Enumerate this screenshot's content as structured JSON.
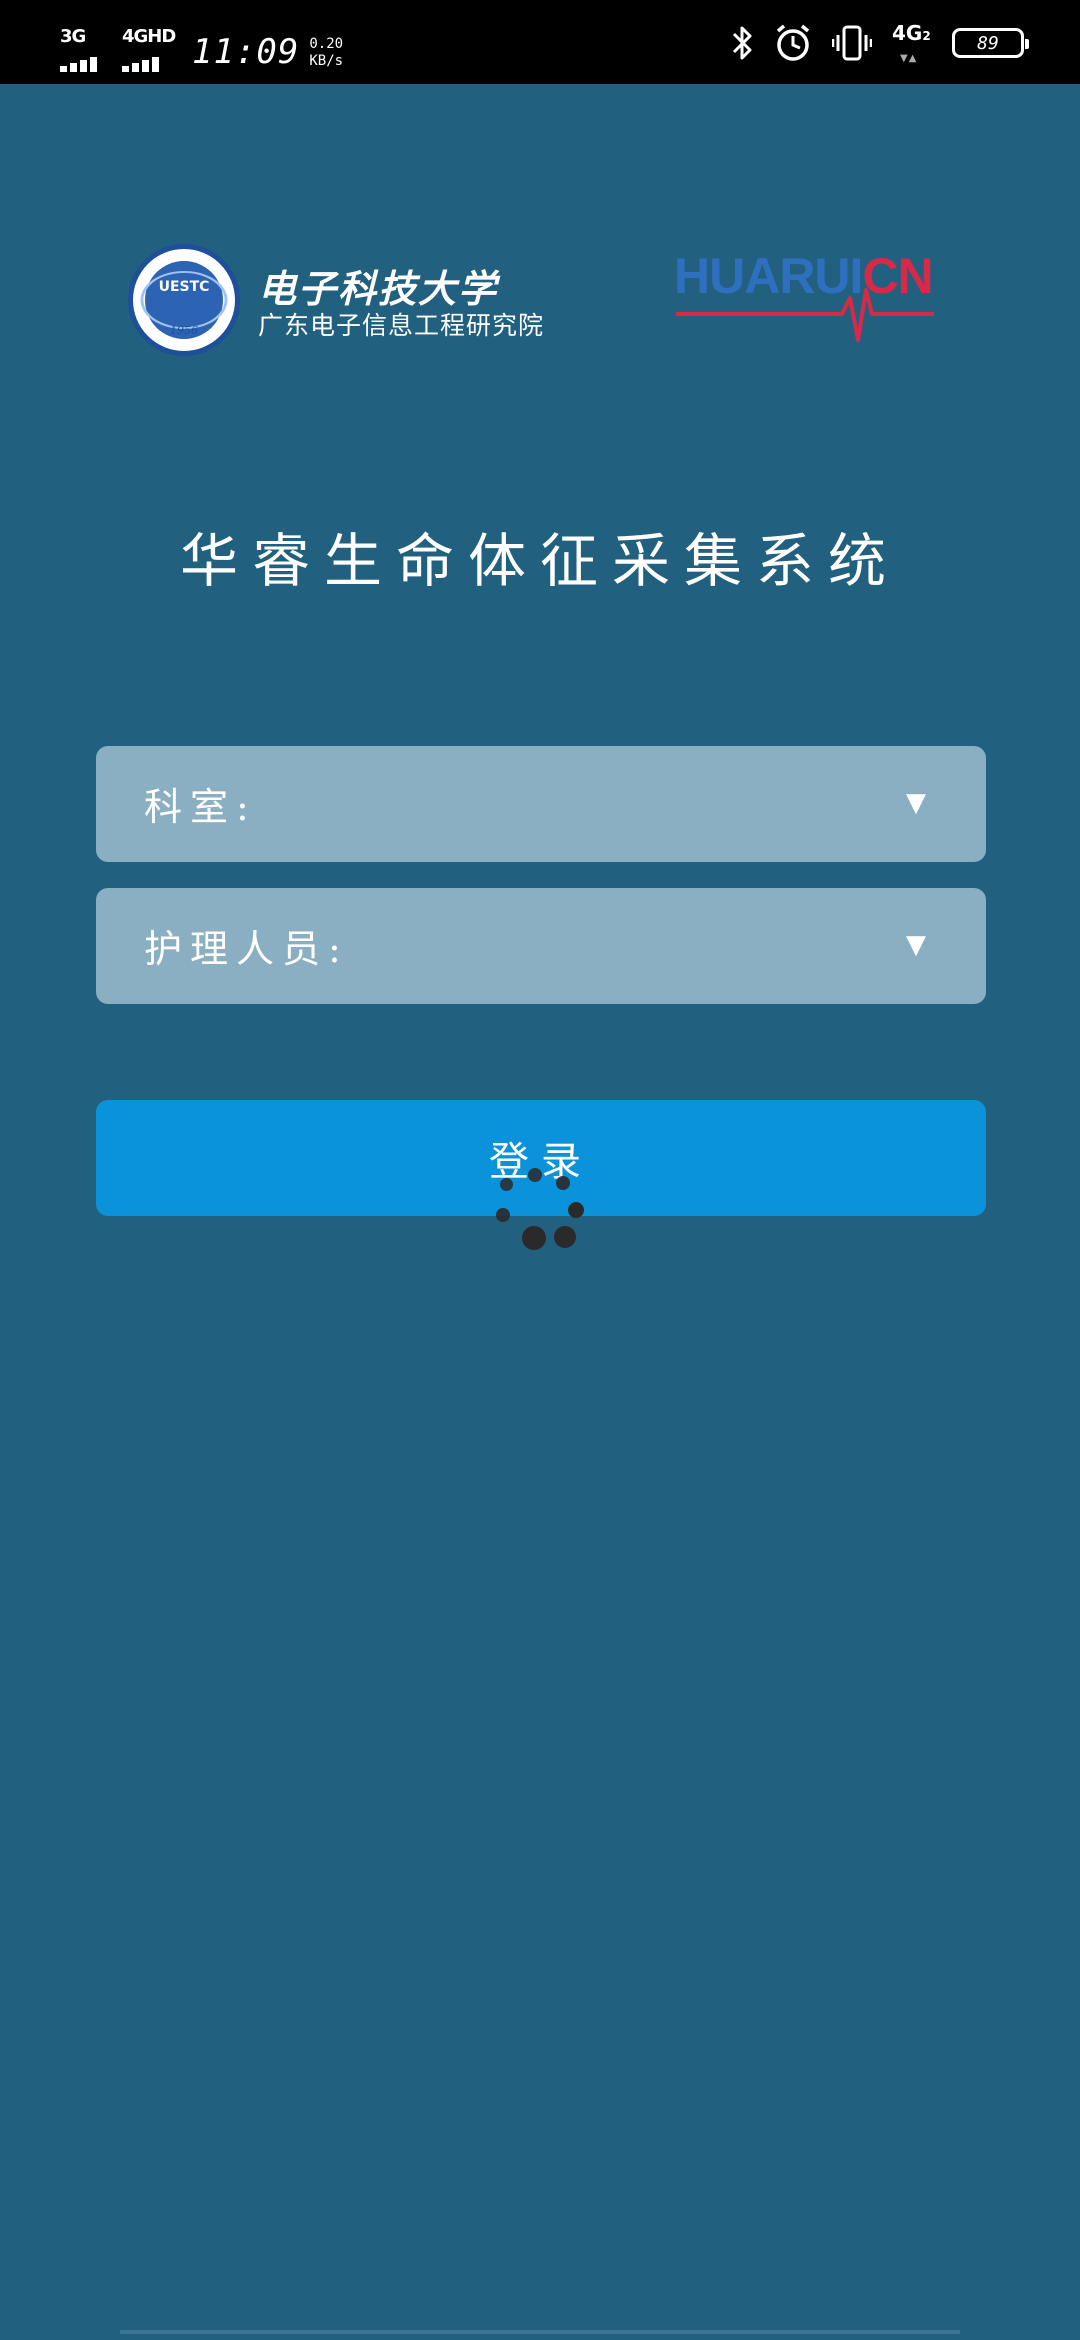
{
  "status_bar": {
    "signal_1_label": "3G",
    "signal_2_label": "4GHD",
    "time": "11:09",
    "speed_value": "0.20",
    "speed_unit": "KB/s",
    "network_label": "4G",
    "network_sub": "2",
    "battery_level": "89",
    "icons": [
      "bluetooth-icon",
      "alarm-icon",
      "vibrate-icon",
      "battery-icon"
    ]
  },
  "logos": {
    "university_seal_text": "UESTC",
    "university_seal_year": "1956",
    "university_name": "电子科技大学",
    "institute_name": "广东电子信息工程研究院",
    "brand_blue": "HUARUI",
    "brand_red": "CN"
  },
  "title": "华睿生命体征采集系统",
  "form": {
    "department_label": "科室:",
    "nurse_label": "护理人员:",
    "dropdown_arrow": "▼"
  },
  "login_button": "登录",
  "colors": {
    "background": "#22607F",
    "field_background": "#8AAFC3",
    "button_background": "#0A92DB",
    "brand_blue": "#2F6FBF",
    "brand_red": "#D62A48"
  }
}
